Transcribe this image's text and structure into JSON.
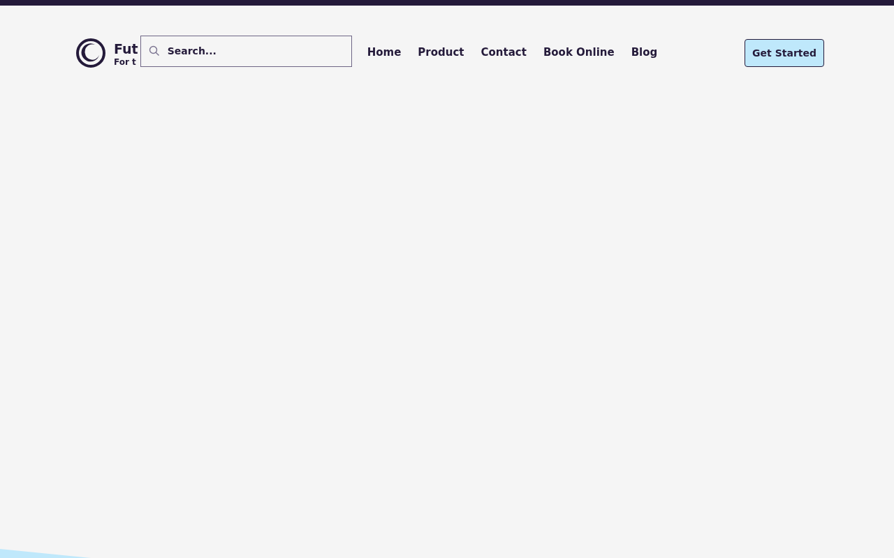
{
  "brand": {
    "name": "Fut",
    "tagline": "For t"
  },
  "search": {
    "placeholder": "Search..."
  },
  "nav": [
    {
      "label": "Home"
    },
    {
      "label": "Product"
    },
    {
      "label": "Contact"
    },
    {
      "label": "Book Online"
    },
    {
      "label": "Blog"
    }
  ],
  "cta": {
    "label": "Get Started"
  }
}
